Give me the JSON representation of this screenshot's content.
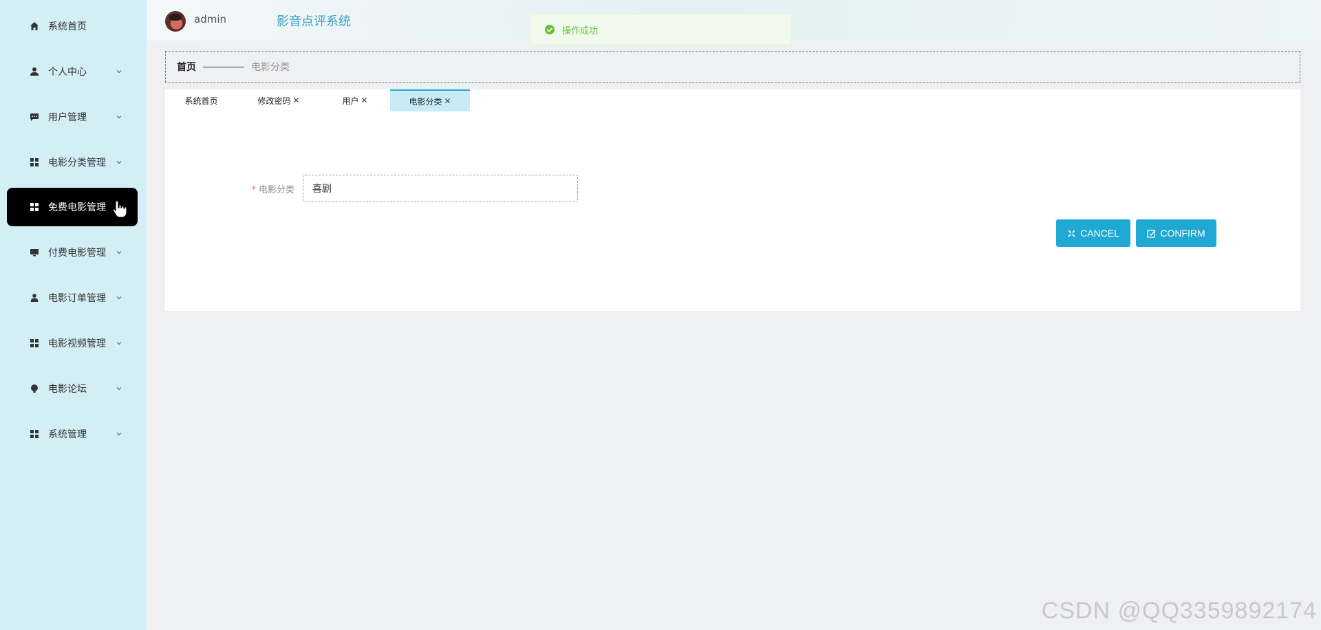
{
  "sidebar": {
    "items": [
      {
        "label": "系统首页",
        "icon": "home-icon",
        "has_submenu": false
      },
      {
        "label": "个人中心",
        "icon": "user-icon",
        "has_submenu": true
      },
      {
        "label": "用户管理",
        "icon": "chat-icon",
        "has_submenu": true
      },
      {
        "label": "电影分类管理",
        "icon": "grid-icon",
        "has_submenu": true
      },
      {
        "label": "免费电影管理",
        "icon": "grid-icon",
        "has_submenu": true,
        "active": true
      },
      {
        "label": "付费电影管理",
        "icon": "monitor-icon",
        "has_submenu": true
      },
      {
        "label": "电影订单管理",
        "icon": "person-icon",
        "has_submenu": true
      },
      {
        "label": "电影视频管理",
        "icon": "grid-icon",
        "has_submenu": true
      },
      {
        "label": "电影论坛",
        "icon": "bulb-icon",
        "has_submenu": true
      },
      {
        "label": "系统管理",
        "icon": "grid-icon",
        "has_submenu": true
      }
    ]
  },
  "header": {
    "username": "admin",
    "app_title": "影音点评系统"
  },
  "toast": {
    "message": "操作成功",
    "icon": "check-circle-icon"
  },
  "breadcrumb": {
    "home": "首页",
    "current": "电影分类"
  },
  "tabs": [
    {
      "label": "系统首页",
      "closable": false
    },
    {
      "label": "修改密码",
      "closable": true
    },
    {
      "label": "用户",
      "closable": true
    },
    {
      "label": "电影分类",
      "closable": true,
      "active": true
    }
  ],
  "form": {
    "required_mark": "*",
    "field_label": "电影分类",
    "field_value": "喜剧"
  },
  "buttons": {
    "cancel": "CANCEL",
    "confirm": "CONFIRM"
  },
  "watermark": "CSDN @QQ3359892174",
  "colors": {
    "sidebar_bg": "#d3eef5",
    "active_menu_bg": "#000000",
    "accent": "#1fa9d2",
    "active_tab_bg": "#c7ecf6",
    "success": "#67c23a"
  }
}
